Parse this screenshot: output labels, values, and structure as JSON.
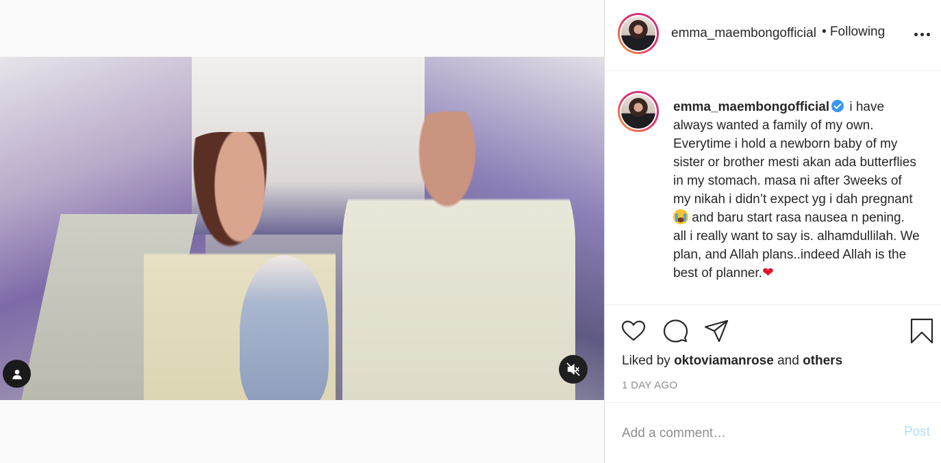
{
  "post": {
    "media": {
      "user_tag_icon": "user-icon",
      "mute_icon": "speaker-muted-icon"
    },
    "header": {
      "username": "emma_maembongofficial",
      "follow_state": "• Following",
      "more_icon": "more-horizontal-icon"
    },
    "caption": {
      "username": "emma_maembongofficial",
      "verified": true,
      "text_1": "i have always wanted a family of my own. Everytime i hold a newborn baby of my sister or brother mesti akan ada butterflies in my stomach. masa ni after 3weeks of my nikah i didn’t expect yg i dah pregnant",
      "emoji_1": "😭",
      "text_2": "and baru start rasa nausea n pening. all i really want to say is. alhamdullilah. We plan, and Allah plans..indeed Allah is the best of planner.",
      "emoji_2": "❤️"
    },
    "actions": {
      "icons": [
        "heart-icon",
        "comment-icon",
        "share-icon",
        "bookmark-icon"
      ],
      "liked_by_prefix": "Liked by",
      "liked_by_user": "oktoviamanrose",
      "liked_by_and": "and",
      "liked_by_others": "others",
      "time": "1 DAY AGO"
    },
    "comment": {
      "placeholder": "Add a comment…",
      "post_label": "Post"
    }
  },
  "colors": {
    "link_disabled": "#b2dffc",
    "verified": "#3897f0",
    "muted_text": "#8e8e8e"
  }
}
